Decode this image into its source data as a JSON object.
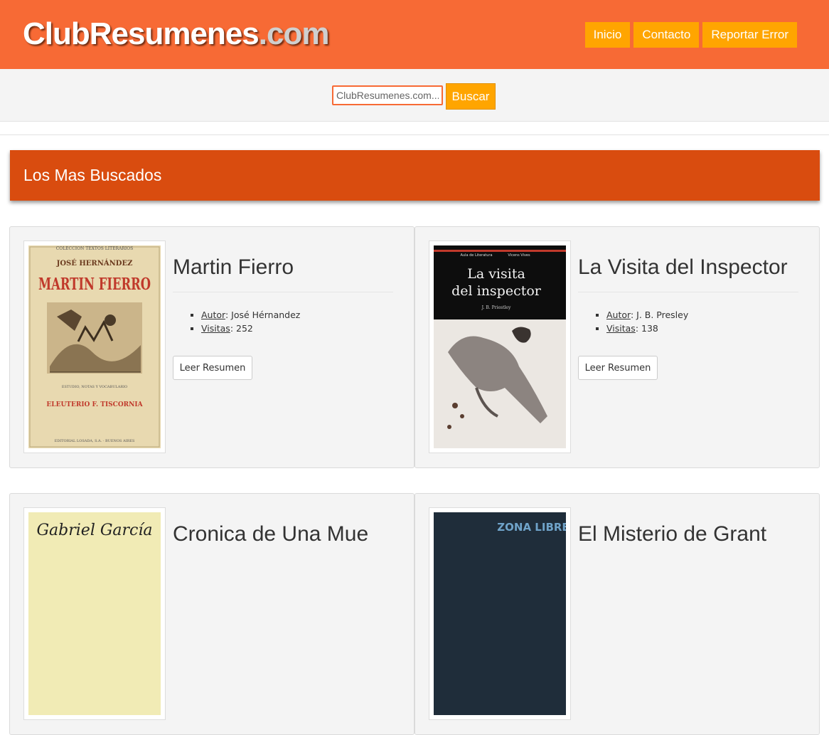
{
  "header": {
    "logo_main": "ClubResumenes",
    "logo_tld": ".com",
    "nav": [
      {
        "label": "Inicio"
      },
      {
        "label": "Contacto"
      },
      {
        "label": "Reportar Error"
      }
    ]
  },
  "search": {
    "placeholder": "ClubResumenes.com...",
    "button_label": "Buscar"
  },
  "section": {
    "title": "Los Mas Buscados"
  },
  "books": [
    {
      "title": "Martin Fierro",
      "author_label": "Autor",
      "author": "José Hérnandez",
      "visits_label": "Visitas",
      "visits": "252",
      "button": "Leer Resumen",
      "cover": {
        "top_line": "COLECCION TEXTOS LITERARIOS",
        "author": "JOSÉ HERNÁNDEZ",
        "title": "MARTIN FIERRO",
        "subtitle": "ESTUDIO, NOTAS Y VOCABULARIO",
        "editor": "ELEUTERIO F. TISCORNIA",
        "publisher": "EDITORIAL LOSADA, S.A. · BUENOS AIRES"
      }
    },
    {
      "title": "La Visita del Inspector",
      "author_label": "Autor",
      "author": "J. B. Presley",
      "visits_label": "Visitas",
      "visits": "138",
      "button": "Leer Resumen",
      "cover": {
        "series": "Aula de Literatura",
        "publisher": "Vicens Vives",
        "title_line1": "La visita",
        "title_line2": "del inspector",
        "author": "J. B. Priestley"
      }
    },
    {
      "title": "Cronica de Una Mue",
      "cover": {
        "text": "Gabriel García"
      }
    },
    {
      "title": "El Misterio de Grant",
      "cover": {
        "text": "ZONA LIBRE"
      }
    }
  ],
  "colors": {
    "header_bg": "#f76a35",
    "accent": "#ffa500",
    "section_bg": "#d94c0f"
  }
}
